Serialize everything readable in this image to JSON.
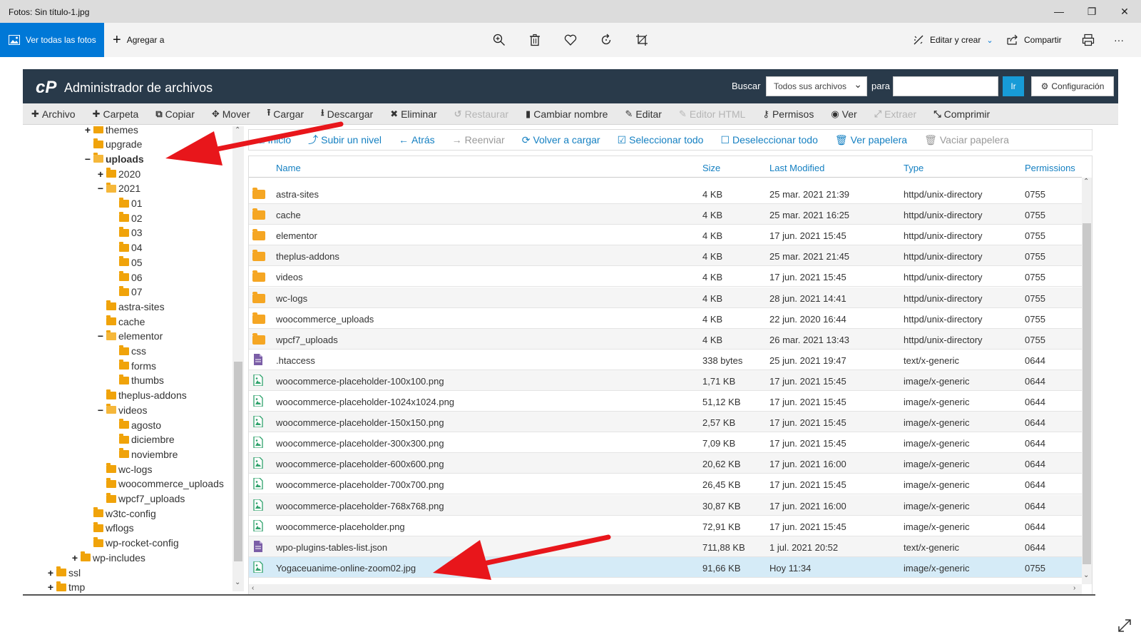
{
  "window": {
    "title": "Fotos: Sin título-1.jpg",
    "minimize": "—",
    "maximize": "❐",
    "close": "✕"
  },
  "photos_toolbar": {
    "view_all": "Ver todas las fotos",
    "add_to": "Agregar a",
    "edit_create": "Editar y crear",
    "share": "Compartir",
    "more": "···"
  },
  "cpanel": {
    "logo": "cP",
    "title": "Administrador de archivos",
    "search_label": "Buscar",
    "search_scope": "Todos sus archivos",
    "for_label": "para",
    "search_value": "",
    "go_label": "Ir",
    "settings_label": "Configuración",
    "toolbar": [
      {
        "label": "Archivo",
        "icon": "plus-icon",
        "glyph": "✚",
        "enabled": true
      },
      {
        "label": "Carpeta",
        "icon": "plus-icon",
        "glyph": "✚",
        "enabled": true
      },
      {
        "label": "Copiar",
        "icon": "copy-icon",
        "glyph": "⧉",
        "enabled": true
      },
      {
        "label": "Mover",
        "icon": "move-icon",
        "glyph": "✥",
        "enabled": true
      },
      {
        "label": "Cargar",
        "icon": "upload-icon",
        "glyph": "⭱",
        "enabled": true
      },
      {
        "label": "Descargar",
        "icon": "download-icon",
        "glyph": "⭳",
        "enabled": true
      },
      {
        "label": "Eliminar",
        "icon": "delete-icon",
        "glyph": "✖",
        "enabled": true
      },
      {
        "label": "Restaurar",
        "icon": "restore-icon",
        "glyph": "↺",
        "enabled": false
      },
      {
        "label": "Cambiar nombre",
        "icon": "file-icon",
        "glyph": "▮",
        "enabled": true
      },
      {
        "label": "Editar",
        "icon": "pencil-icon",
        "glyph": "✎",
        "enabled": true
      },
      {
        "label": "Editor HTML",
        "icon": "html-editor-icon",
        "glyph": "✎",
        "enabled": false
      },
      {
        "label": "Permisos",
        "icon": "key-icon",
        "glyph": "⚷",
        "enabled": true
      },
      {
        "label": "Ver",
        "icon": "eye-icon",
        "glyph": "◉",
        "enabled": true
      },
      {
        "label": "Extraer",
        "icon": "extract-icon",
        "glyph": "⤢",
        "enabled": false
      },
      {
        "label": "Comprimir",
        "icon": "compress-icon",
        "glyph": "⤡",
        "enabled": true
      }
    ],
    "nav": [
      {
        "label": "Inicio",
        "icon": "home-icon",
        "glyph": "⌂",
        "enabled": true
      },
      {
        "label": "Subir un nivel",
        "icon": "level-up-icon",
        "glyph": "⤴",
        "enabled": true
      },
      {
        "label": "Atrás",
        "icon": "back-arrow-icon",
        "glyph": "←",
        "enabled": true
      },
      {
        "label": "Reenviar",
        "icon": "forward-arrow-icon",
        "glyph": "→",
        "enabled": false
      },
      {
        "label": "Volver a cargar",
        "icon": "reload-icon",
        "glyph": "⟳",
        "enabled": true
      },
      {
        "label": "Seleccionar todo",
        "icon": "check-square-icon",
        "glyph": "☑",
        "enabled": true
      },
      {
        "label": "Deseleccionar todo",
        "icon": "square-icon",
        "glyph": "☐",
        "enabled": true
      },
      {
        "label": "Ver papelera",
        "icon": "trash-icon",
        "glyph": "🗑",
        "enabled": true
      },
      {
        "label": "Vaciar papelera",
        "icon": "trash-icon",
        "glyph": "🗑",
        "enabled": false
      }
    ],
    "columns": {
      "name": "Name",
      "size": "Size",
      "modified": "Last Modified",
      "type": "Type",
      "permissions": "Permissions"
    },
    "tree": [
      {
        "label": "themes",
        "level": 3,
        "toggle": "+",
        "open": false,
        "bold": false
      },
      {
        "label": "upgrade",
        "level": 3,
        "toggle": "",
        "open": false,
        "bold": false
      },
      {
        "label": "uploads",
        "level": 3,
        "toggle": "−",
        "open": true,
        "bold": true
      },
      {
        "label": "2020",
        "level": 4,
        "toggle": "+",
        "open": false,
        "bold": false
      },
      {
        "label": "2021",
        "level": 4,
        "toggle": "−",
        "open": true,
        "bold": false
      },
      {
        "label": "01",
        "level": 5,
        "toggle": "",
        "open": false,
        "bold": false
      },
      {
        "label": "02",
        "level": 5,
        "toggle": "",
        "open": false,
        "bold": false
      },
      {
        "label": "03",
        "level": 5,
        "toggle": "",
        "open": false,
        "bold": false
      },
      {
        "label": "04",
        "level": 5,
        "toggle": "",
        "open": false,
        "bold": false
      },
      {
        "label": "05",
        "level": 5,
        "toggle": "",
        "open": false,
        "bold": false
      },
      {
        "label": "06",
        "level": 5,
        "toggle": "",
        "open": false,
        "bold": false
      },
      {
        "label": "07",
        "level": 5,
        "toggle": "",
        "open": false,
        "bold": false
      },
      {
        "label": "astra-sites",
        "level": 4,
        "toggle": "",
        "open": false,
        "bold": false
      },
      {
        "label": "cache",
        "level": 4,
        "toggle": "",
        "open": false,
        "bold": false
      },
      {
        "label": "elementor",
        "level": 4,
        "toggle": "−",
        "open": true,
        "bold": false
      },
      {
        "label": "css",
        "level": 5,
        "toggle": "",
        "open": false,
        "bold": false
      },
      {
        "label": "forms",
        "level": 5,
        "toggle": "",
        "open": false,
        "bold": false
      },
      {
        "label": "thumbs",
        "level": 5,
        "toggle": "",
        "open": false,
        "bold": false
      },
      {
        "label": "theplus-addons",
        "level": 4,
        "toggle": "",
        "open": false,
        "bold": false
      },
      {
        "label": "videos",
        "level": 4,
        "toggle": "−",
        "open": true,
        "bold": false
      },
      {
        "label": "agosto",
        "level": 5,
        "toggle": "",
        "open": false,
        "bold": false
      },
      {
        "label": "diciembre",
        "level": 5,
        "toggle": "",
        "open": false,
        "bold": false
      },
      {
        "label": "noviembre",
        "level": 5,
        "toggle": "",
        "open": false,
        "bold": false
      },
      {
        "label": "wc-logs",
        "level": 4,
        "toggle": "",
        "open": false,
        "bold": false
      },
      {
        "label": "woocommerce_uploads",
        "level": 4,
        "toggle": "",
        "open": false,
        "bold": false
      },
      {
        "label": "wpcf7_uploads",
        "level": 4,
        "toggle": "",
        "open": false,
        "bold": false
      },
      {
        "label": "w3tc-config",
        "level": 3,
        "toggle": "",
        "open": false,
        "bold": false
      },
      {
        "label": "wflogs",
        "level": 3,
        "toggle": "",
        "open": false,
        "bold": false
      },
      {
        "label": "wp-rocket-config",
        "level": 3,
        "toggle": "",
        "open": false,
        "bold": false
      },
      {
        "label": "wp-includes",
        "level": 2,
        "toggle": "+",
        "open": false,
        "bold": false
      },
      {
        "label": "ssl",
        "level": 1,
        "toggle": "+",
        "open": false,
        "bold": false
      },
      {
        "label": "tmp",
        "level": 1,
        "toggle": "+",
        "open": false,
        "bold": false
      }
    ],
    "files": [
      {
        "name": "astra-sites",
        "size": "4 KB",
        "modified": "25 mar. 2021 21:39",
        "type": "httpd/unix-directory",
        "perm": "0755",
        "kind": "folder",
        "selected": false
      },
      {
        "name": "cache",
        "size": "4 KB",
        "modified": "25 mar. 2021 16:25",
        "type": "httpd/unix-directory",
        "perm": "0755",
        "kind": "folder",
        "selected": false
      },
      {
        "name": "elementor",
        "size": "4 KB",
        "modified": "17 jun. 2021 15:45",
        "type": "httpd/unix-directory",
        "perm": "0755",
        "kind": "folder",
        "selected": false
      },
      {
        "name": "theplus-addons",
        "size": "4 KB",
        "modified": "25 mar. 2021 21:45",
        "type": "httpd/unix-directory",
        "perm": "0755",
        "kind": "folder",
        "selected": false
      },
      {
        "name": "videos",
        "size": "4 KB",
        "modified": "17 jun. 2021 15:45",
        "type": "httpd/unix-directory",
        "perm": "0755",
        "kind": "folder",
        "selected": false
      },
      {
        "name": "wc-logs",
        "size": "4 KB",
        "modified": "28 jun. 2021 14:41",
        "type": "httpd/unix-directory",
        "perm": "0755",
        "kind": "folder",
        "selected": false
      },
      {
        "name": "woocommerce_uploads",
        "size": "4 KB",
        "modified": "22 jun. 2020 16:44",
        "type": "httpd/unix-directory",
        "perm": "0755",
        "kind": "folder",
        "selected": false
      },
      {
        "name": "wpcf7_uploads",
        "size": "4 KB",
        "modified": "26 mar. 2021 13:43",
        "type": "httpd/unix-directory",
        "perm": "0755",
        "kind": "folder",
        "selected": false
      },
      {
        "name": ".htaccess",
        "size": "338 bytes",
        "modified": "25 jun. 2021 19:47",
        "type": "text/x-generic",
        "perm": "0644",
        "kind": "text",
        "selected": false
      },
      {
        "name": "woocommerce-placeholder-100x100.png",
        "size": "1,71 KB",
        "modified": "17 jun. 2021 15:45",
        "type": "image/x-generic",
        "perm": "0644",
        "kind": "image",
        "selected": false
      },
      {
        "name": "woocommerce-placeholder-1024x1024.png",
        "size": "51,12 KB",
        "modified": "17 jun. 2021 15:45",
        "type": "image/x-generic",
        "perm": "0644",
        "kind": "image",
        "selected": false
      },
      {
        "name": "woocommerce-placeholder-150x150.png",
        "size": "2,57 KB",
        "modified": "17 jun. 2021 15:45",
        "type": "image/x-generic",
        "perm": "0644",
        "kind": "image",
        "selected": false
      },
      {
        "name": "woocommerce-placeholder-300x300.png",
        "size": "7,09 KB",
        "modified": "17 jun. 2021 15:45",
        "type": "image/x-generic",
        "perm": "0644",
        "kind": "image",
        "selected": false
      },
      {
        "name": "woocommerce-placeholder-600x600.png",
        "size": "20,62 KB",
        "modified": "17 jun. 2021 16:00",
        "type": "image/x-generic",
        "perm": "0644",
        "kind": "image",
        "selected": false
      },
      {
        "name": "woocommerce-placeholder-700x700.png",
        "size": "26,45 KB",
        "modified": "17 jun. 2021 15:45",
        "type": "image/x-generic",
        "perm": "0644",
        "kind": "image",
        "selected": false
      },
      {
        "name": "woocommerce-placeholder-768x768.png",
        "size": "30,87 KB",
        "modified": "17 jun. 2021 16:00",
        "type": "image/x-generic",
        "perm": "0644",
        "kind": "image",
        "selected": false
      },
      {
        "name": "woocommerce-placeholder.png",
        "size": "72,91 KB",
        "modified": "17 jun. 2021 15:45",
        "type": "image/x-generic",
        "perm": "0644",
        "kind": "image",
        "selected": false
      },
      {
        "name": "wpo-plugins-tables-list.json",
        "size": "711,88 KB",
        "modified": "1 jul. 2021 20:52",
        "type": "text/x-generic",
        "perm": "0644",
        "kind": "text",
        "selected": false
      },
      {
        "name": "Yogaceuanime-online-zoom02.jpg",
        "size": "91,66 KB",
        "modified": "Hoy 11:34",
        "type": "image/x-generic",
        "perm": "0755",
        "kind": "image",
        "selected": true
      }
    ]
  },
  "colors": {
    "accent": "#0078d7",
    "cpanel_header": "#293a4a",
    "link": "#1580c2",
    "selected_row": "#d5ebf7",
    "annotation_arrow": "#e8161b"
  }
}
